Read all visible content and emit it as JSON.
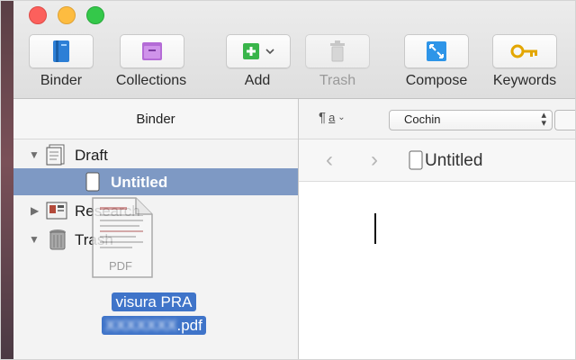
{
  "toolbar": {
    "items": [
      {
        "label": "Binder",
        "icon": "binder-icon",
        "enabled": true
      },
      {
        "label": "Collections",
        "icon": "collections-icon",
        "enabled": true
      },
      {
        "label": "Add",
        "icon": "add-icon",
        "enabled": true
      },
      {
        "label": "Trash",
        "icon": "trash-icon",
        "enabled": false
      },
      {
        "label": "Compose",
        "icon": "compose-icon",
        "enabled": true
      },
      {
        "label": "Keywords",
        "icon": "keywords-icon",
        "enabled": true
      }
    ]
  },
  "sidebar": {
    "header": "Binder",
    "items": [
      {
        "label": "Draft",
        "icon": "draft-folder-icon",
        "expanded": true
      },
      {
        "label": "Untitled",
        "icon": "document-icon",
        "selected": true
      },
      {
        "label": "Research",
        "icon": "research-folder-icon",
        "expanded": false
      },
      {
        "label": "Trash",
        "icon": "trash-can-icon",
        "expanded": true
      }
    ]
  },
  "drag": {
    "file_type": "PDF",
    "filename_line1": "visura PRA",
    "filename_line2_hidden": "XXXXXXX",
    "filename_line2_ext": ".pdf"
  },
  "format_bar": {
    "paragraph_symbol": "¶",
    "font_name": "Cochin"
  },
  "editor": {
    "doc_title": "Untitled",
    "back_arrow": "‹",
    "forward_arrow": "›"
  },
  "colors": {
    "selection": "#7e99c4",
    "drag_highlight": "#3f74c9",
    "traffic_close": "#fc605c",
    "traffic_min": "#fdbc40",
    "traffic_max": "#34c84a"
  }
}
